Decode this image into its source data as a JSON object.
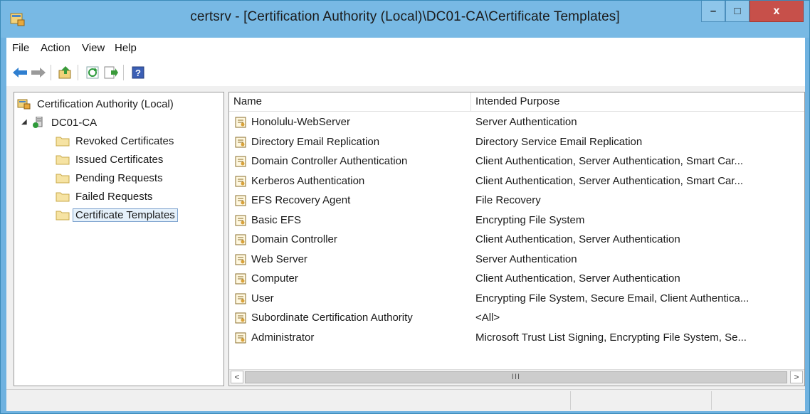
{
  "window": {
    "title": "certsrv - [Certification Authority (Local)\\DC01-CA\\Certificate Templates]",
    "minimize_label": "–",
    "maximize_label": "□",
    "close_label": "x"
  },
  "menu": {
    "items": [
      {
        "label": "File"
      },
      {
        "label": "Action"
      },
      {
        "label": "View"
      },
      {
        "label": "Help"
      }
    ]
  },
  "toolbar": {
    "icons": [
      "back-icon",
      "forward-icon",
      "up-level-icon",
      "refresh-icon",
      "export-list-icon",
      "help-icon"
    ]
  },
  "tree": {
    "root": "Certification Authority (Local)",
    "ca": "DC01-CA",
    "children": [
      {
        "label": "Revoked Certificates"
      },
      {
        "label": "Issued Certificates"
      },
      {
        "label": "Pending Requests"
      },
      {
        "label": "Failed Requests"
      },
      {
        "label": "Certificate Templates",
        "selected": true
      }
    ]
  },
  "list": {
    "columns": [
      "Name",
      "Intended Purpose"
    ],
    "rows": [
      {
        "name": "Honolulu-WebServer",
        "purpose": "Server Authentication"
      },
      {
        "name": "Directory Email Replication",
        "purpose": "Directory Service Email Replication"
      },
      {
        "name": "Domain Controller Authentication",
        "purpose": "Client Authentication, Server Authentication, Smart Car..."
      },
      {
        "name": "Kerberos Authentication",
        "purpose": "Client Authentication, Server Authentication, Smart Car..."
      },
      {
        "name": "EFS Recovery Agent",
        "purpose": "File Recovery"
      },
      {
        "name": "Basic EFS",
        "purpose": "Encrypting File System"
      },
      {
        "name": "Domain Controller",
        "purpose": "Client Authentication, Server Authentication"
      },
      {
        "name": "Web Server",
        "purpose": "Server Authentication"
      },
      {
        "name": "Computer",
        "purpose": "Client Authentication, Server Authentication"
      },
      {
        "name": "User",
        "purpose": "Encrypting File System, Secure Email, Client Authentica..."
      },
      {
        "name": "Subordinate Certification Authority",
        "purpose": "<All>"
      },
      {
        "name": "Administrator",
        "purpose": "Microsoft Trust List Signing, Encrypting File System, Se..."
      }
    ]
  },
  "scrollbar": {
    "left_arrow": "<",
    "right_arrow": ">",
    "thumb_grip": "III"
  },
  "colors": {
    "title_bar": "#78b9e4",
    "close_button": "#c7504a",
    "selection": "#e5f1fb"
  }
}
